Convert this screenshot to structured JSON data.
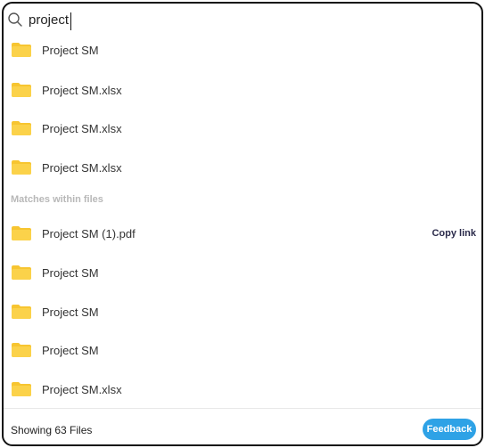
{
  "search": {
    "value": "project",
    "icon": "search-icon"
  },
  "results": [
    {
      "label": "Project SM",
      "icon": "folder-icon"
    },
    {
      "label": "Project SM.xlsx",
      "icon": "folder-icon"
    },
    {
      "label": "Project SM.xlsx",
      "icon": "folder-icon"
    },
    {
      "label": "Project SM.xlsx",
      "icon": "folder-icon"
    }
  ],
  "matches_section": {
    "title": "Matches within files",
    "items": [
      {
        "label": "Project SM (1).pdf",
        "icon": "folder-icon",
        "action": "Copy link"
      },
      {
        "label": "Project SM",
        "icon": "folder-icon"
      },
      {
        "label": "Project SM",
        "icon": "folder-icon"
      },
      {
        "label": "Project SM",
        "icon": "folder-icon"
      },
      {
        "label": "Project SM.xlsx",
        "icon": "folder-icon"
      }
    ]
  },
  "footer": {
    "count_text": "Showing 63 Files",
    "feedback_label": "Feedback"
  },
  "colors": {
    "folder": "#f7c531",
    "folder_dark": "#e8b21e",
    "accent": "#2ea2e6",
    "border": "#111111"
  }
}
